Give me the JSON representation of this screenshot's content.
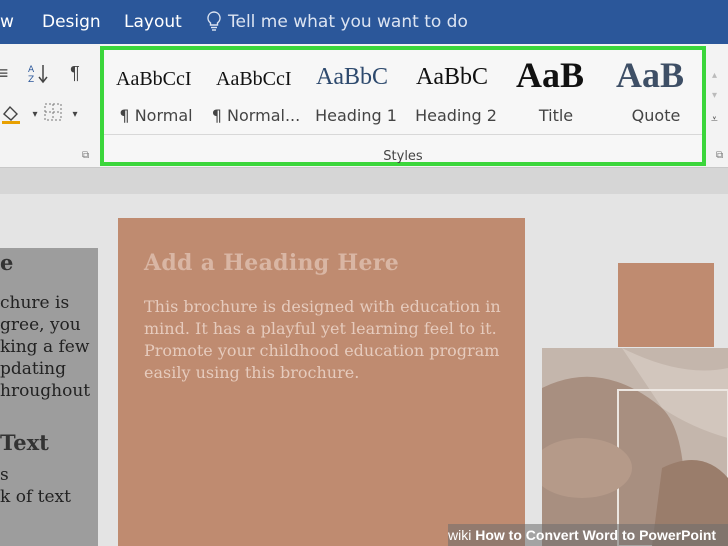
{
  "ribbon_tabs": {
    "partial_tab": "w",
    "design": "Design",
    "layout": "Layout"
  },
  "tell_me": "Tell me what you want to do",
  "styles": {
    "items": [
      {
        "preview": "AaBbCcI",
        "label": "¶ Normal"
      },
      {
        "preview": "AaBbCcI",
        "label": "¶ Normal..."
      },
      {
        "preview": "AaBbC",
        "label": "Heading 1"
      },
      {
        "preview": "AaBbC",
        "label": "Heading 2"
      },
      {
        "preview": "AaB",
        "label": "Title"
      },
      {
        "preview": "AaB",
        "label": "Quote"
      }
    ],
    "group_title": "Styles"
  },
  "document": {
    "left_heading": "e",
    "left_lines": [
      "chure is",
      "gree, you",
      "king a few",
      "pdating",
      "hroughout"
    ],
    "left_heading2": "Text",
    "left_lines2": [
      "s",
      "k of text"
    ],
    "block_heading": "Add a Heading Here",
    "block_body": "This brochure is designed with education in mind.  It has a playful yet learning feel to it.  Promote your childhood education program easily using this brochure."
  },
  "watermark": {
    "brand": "wiki",
    "title": "How to Convert Word to PowerPoint"
  },
  "colors": {
    "ribbon_blue": "#2b579a",
    "highlight_green": "#3bd63b",
    "orange_block": "#bf8b70"
  }
}
